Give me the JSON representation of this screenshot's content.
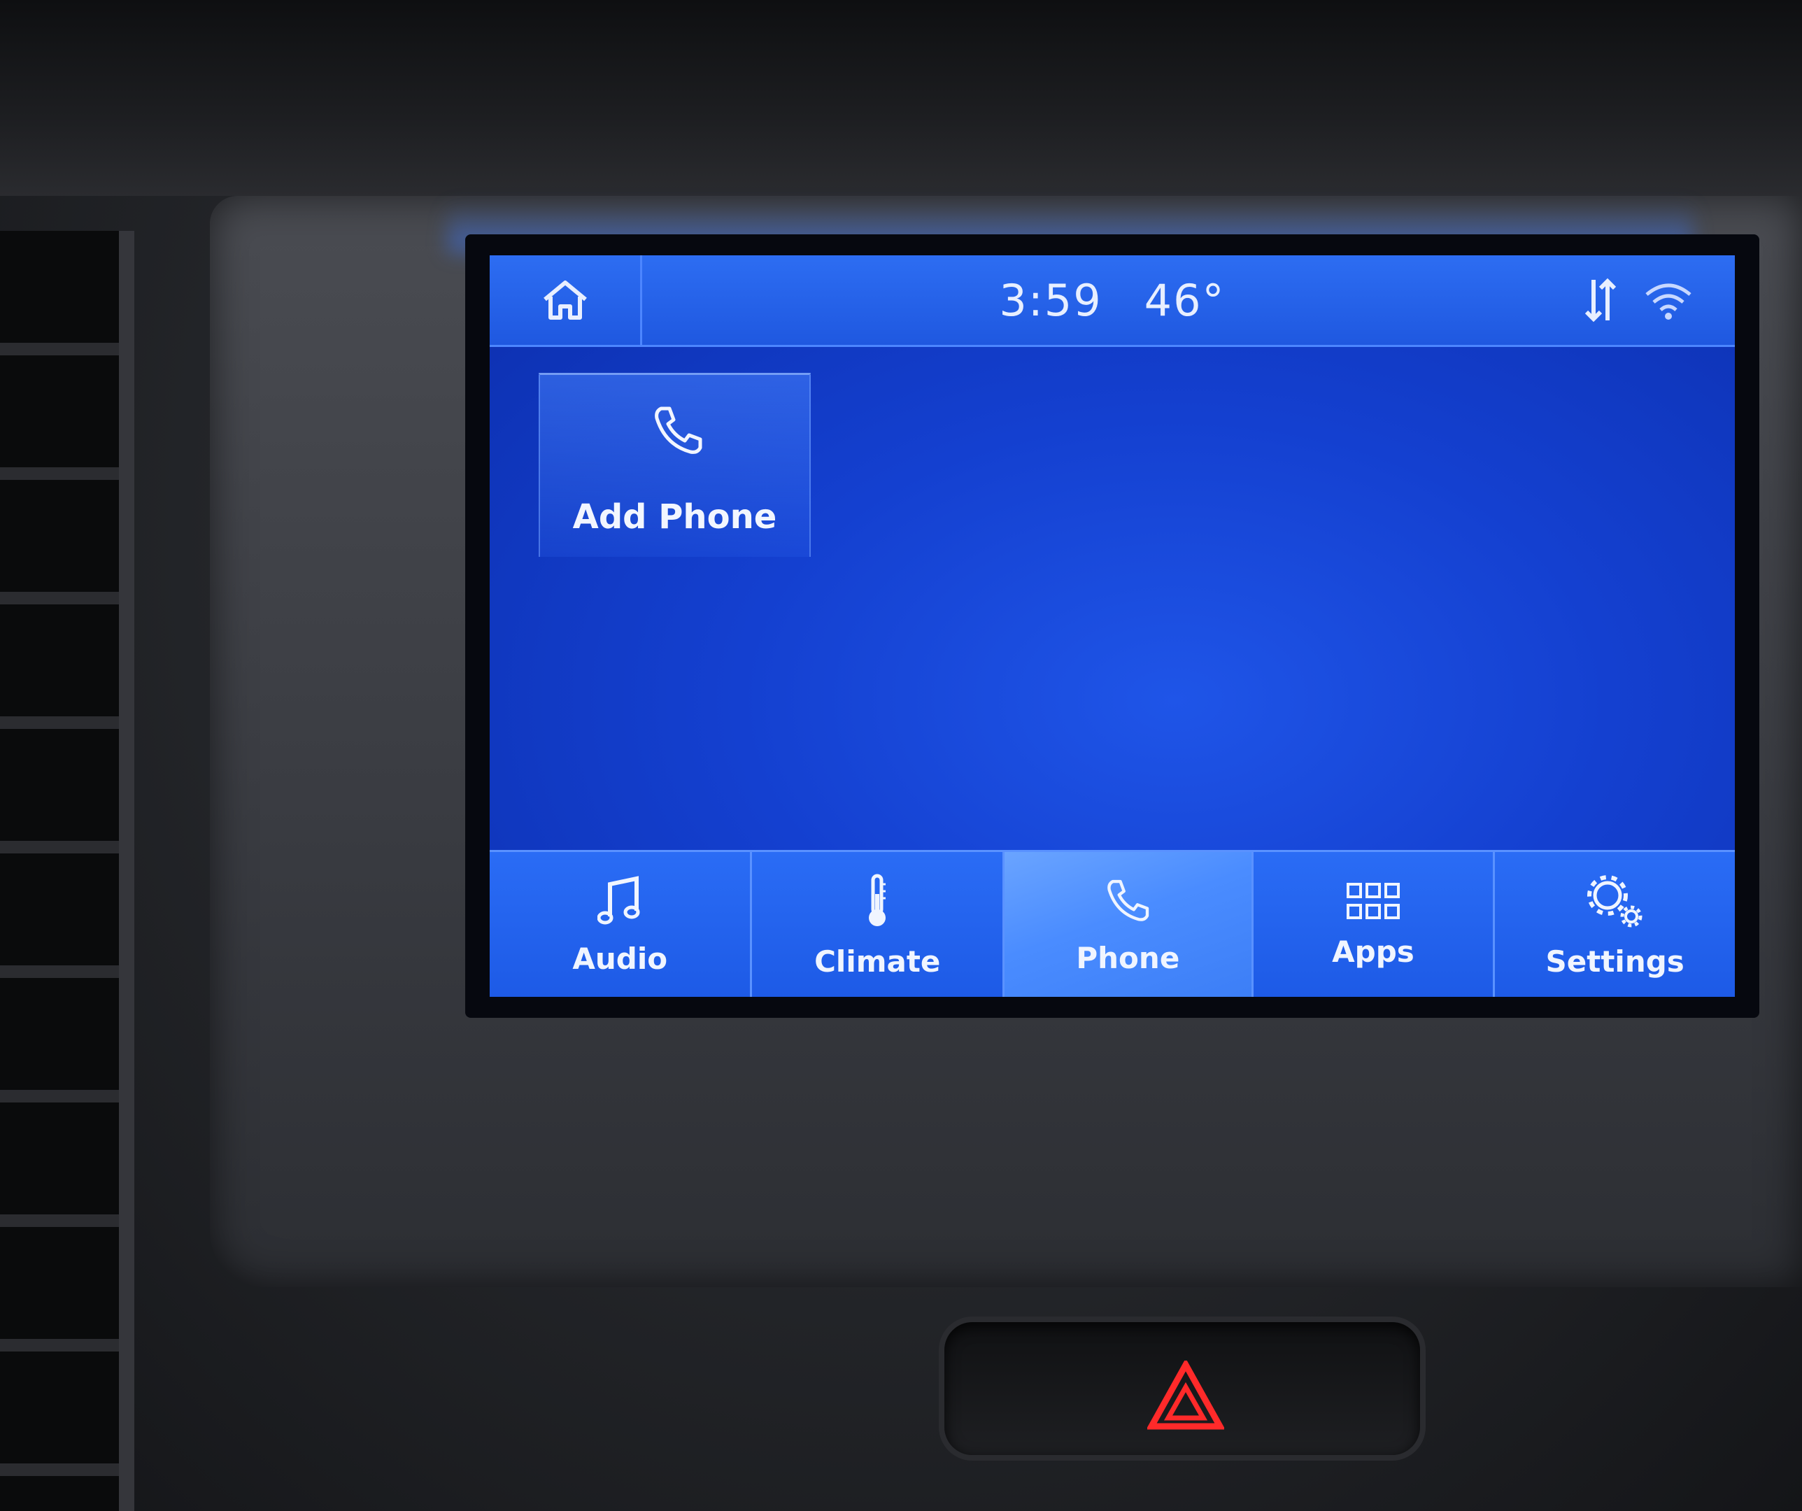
{
  "status_bar": {
    "time": "3:59",
    "temperature": "46°",
    "home_icon": "home-icon",
    "data_icon": "data-transfer-icon",
    "wifi_icon": "wifi-icon"
  },
  "main": {
    "tile": {
      "label": "Add Phone",
      "icon": "phone-icon"
    }
  },
  "nav": {
    "items": [
      {
        "label": "Audio",
        "icon": "music-note-icon"
      },
      {
        "label": "Climate",
        "icon": "thermometer-icon"
      },
      {
        "label": "Phone",
        "icon": "phone-icon",
        "active": true
      },
      {
        "label": "Apps",
        "icon": "grid-icon"
      },
      {
        "label": "Settings",
        "icon": "gear-icon"
      }
    ]
  },
  "colors": {
    "screen_blue": "#1440d0",
    "bar_blue": "#2a6cf5",
    "active_tab": "#4a8cff",
    "hazard_red": "#ff2a2a"
  }
}
